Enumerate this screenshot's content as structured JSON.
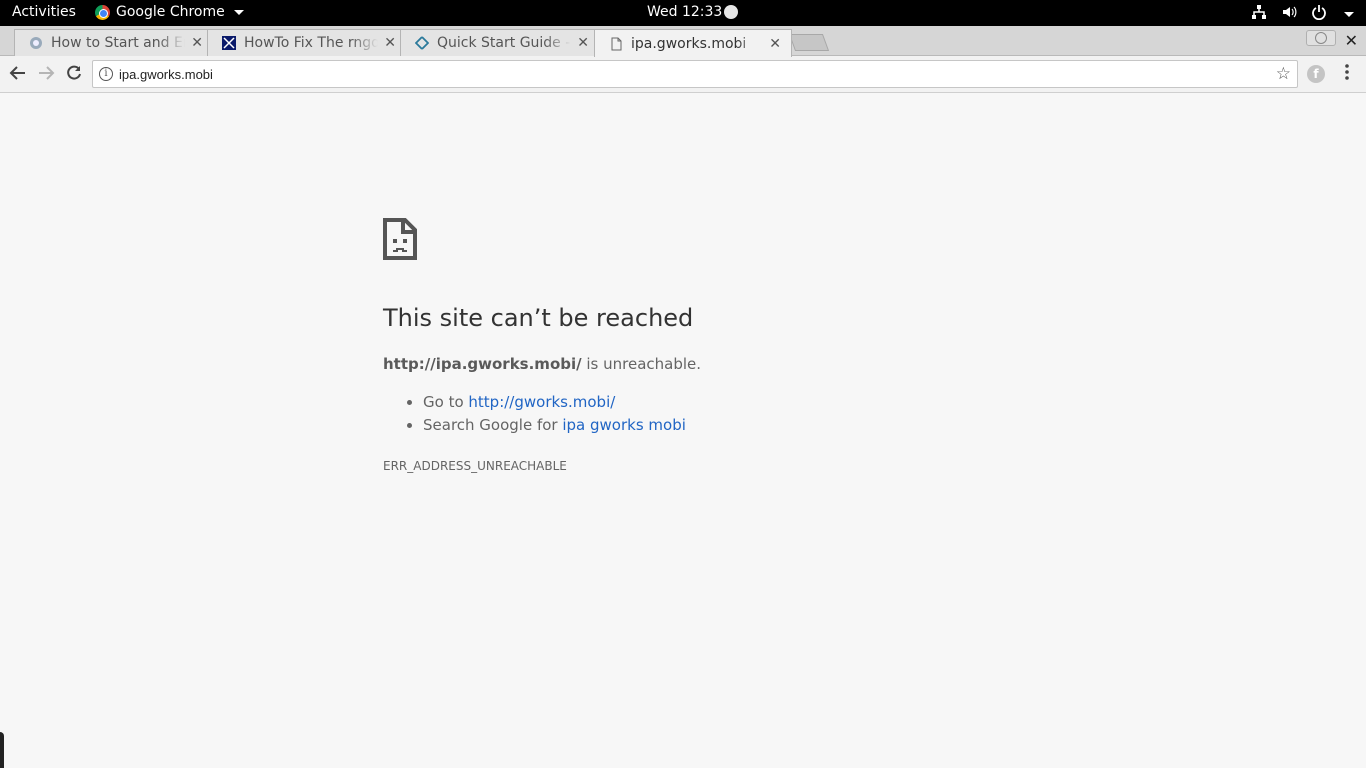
{
  "topbar": {
    "activities": "Activities",
    "app_name": "Google Chrome",
    "clock": "Wed 12:33"
  },
  "tabs": [
    {
      "title": "How to Start and En",
      "active": false
    },
    {
      "title": "HowTo Fix The rngd",
      "active": false
    },
    {
      "title": "Quick Start Guide - I",
      "active": false
    },
    {
      "title": "ipa.gworks.mobi",
      "active": true
    }
  ],
  "toolbar": {
    "url": "ipa.gworks.mobi"
  },
  "error": {
    "title": "This site can’t be reached",
    "host": "http://ipa.gworks.mobi/",
    "host_suffix": " is unreachable.",
    "suggestions": [
      {
        "prefix": "Go to ",
        "link": "http://gworks.mobi/"
      },
      {
        "prefix": "Search Google for ",
        "link": "ipa gworks mobi"
      }
    ],
    "code": "ERR_ADDRESS_UNREACHABLE"
  },
  "colors": {
    "link": "#2165c4",
    "page_bg": "#f7f7f7"
  }
}
